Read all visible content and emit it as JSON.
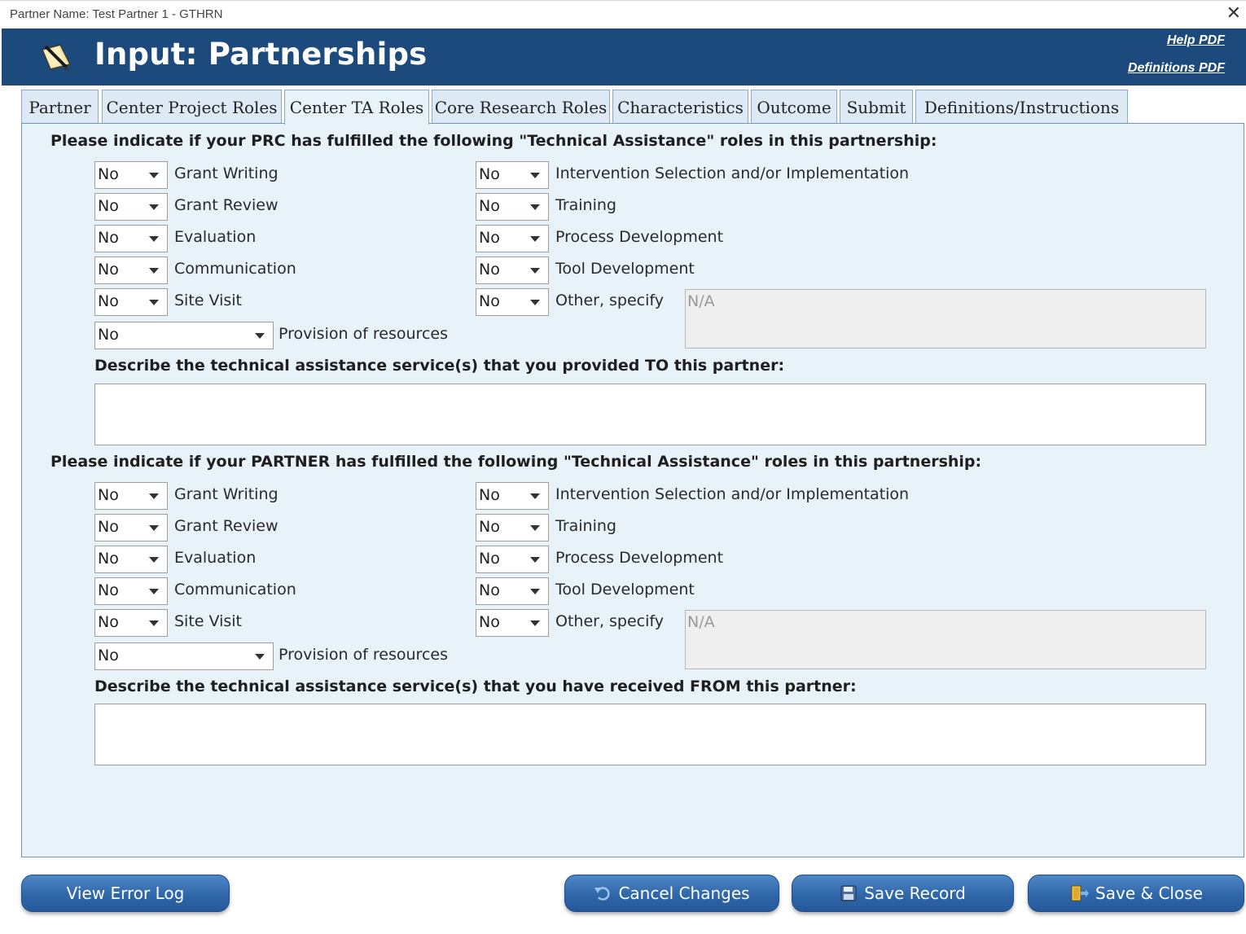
{
  "window": {
    "title": "Partner Name: Test Partner 1 - GTHRN"
  },
  "header": {
    "title": "Input: Partnerships",
    "help_link": "Help PDF",
    "definitions_link": "Definitions PDF"
  },
  "tabs": [
    {
      "label": "Partner"
    },
    {
      "label": "Center Project Roles"
    },
    {
      "label": "Center TA Roles"
    },
    {
      "label": "Core Research Roles"
    },
    {
      "label": "Characteristics"
    },
    {
      "label": "Outcome"
    },
    {
      "label": "Submit"
    },
    {
      "label": "Definitions/Instructions"
    }
  ],
  "active_tab": "Center TA Roles",
  "prc_section": {
    "heading": "Please indicate if your PRC has fulfilled the following \"Technical Assistance\" roles in this partnership:",
    "left_roles": [
      {
        "label": "Grant Writing",
        "value": "No"
      },
      {
        "label": "Grant Review",
        "value": "No"
      },
      {
        "label": "Evaluation",
        "value": "No"
      },
      {
        "label": "Communication",
        "value": "No"
      },
      {
        "label": "Site Visit",
        "value": "No"
      }
    ],
    "right_roles": [
      {
        "label": "Intervention Selection and/or Implementation",
        "value": "No"
      },
      {
        "label": "Training",
        "value": "No"
      },
      {
        "label": "Process Development",
        "value": "No"
      },
      {
        "label": "Tool Development",
        "value": "No"
      },
      {
        "label": "Other, specify",
        "value": "No"
      }
    ],
    "other_specify_value": "N/A",
    "provision": {
      "label": "Provision of resources",
      "value": "No"
    },
    "describe_label": "Describe the technical assistance service(s) that you provided TO this partner:",
    "describe_value": ""
  },
  "partner_section": {
    "heading": "Please indicate if your PARTNER has fulfilled the following \"Technical Assistance\" roles in this partnership:",
    "left_roles": [
      {
        "label": "Grant Writing",
        "value": "No"
      },
      {
        "label": "Grant Review",
        "value": "No"
      },
      {
        "label": "Evaluation",
        "value": "No"
      },
      {
        "label": "Communication",
        "value": "No"
      },
      {
        "label": "Site Visit",
        "value": "No"
      }
    ],
    "right_roles": [
      {
        "label": "Intervention Selection and/or Implementation",
        "value": "No"
      },
      {
        "label": "Training",
        "value": "No"
      },
      {
        "label": "Process Development",
        "value": "No"
      },
      {
        "label": "Tool Development",
        "value": "No"
      },
      {
        "label": "Other, specify",
        "value": "No"
      }
    ],
    "other_specify_value": "N/A",
    "provision": {
      "label": "Provision of resources",
      "value": "No"
    },
    "describe_label": "Describe the technical assistance service(s) that you have received FROM this partner:",
    "describe_value": ""
  },
  "buttons": {
    "view_error_log": "View Error Log",
    "cancel_changes": "Cancel Changes",
    "save_record": "Save Record",
    "save_close": "Save & Close"
  },
  "colors": {
    "header_bg": "#1d4a7c",
    "panel_bg": "#e8f2f9",
    "tab_bg": "#dde9f4",
    "button_bg": "#2f67a9"
  },
  "icons": {
    "logo": "notepad-pencil-icon",
    "close": "close-icon",
    "dropdown": "chevron-down-icon",
    "cancel": "undo-icon",
    "save": "floppy-disk-icon",
    "save_close": "door-exit-icon"
  }
}
